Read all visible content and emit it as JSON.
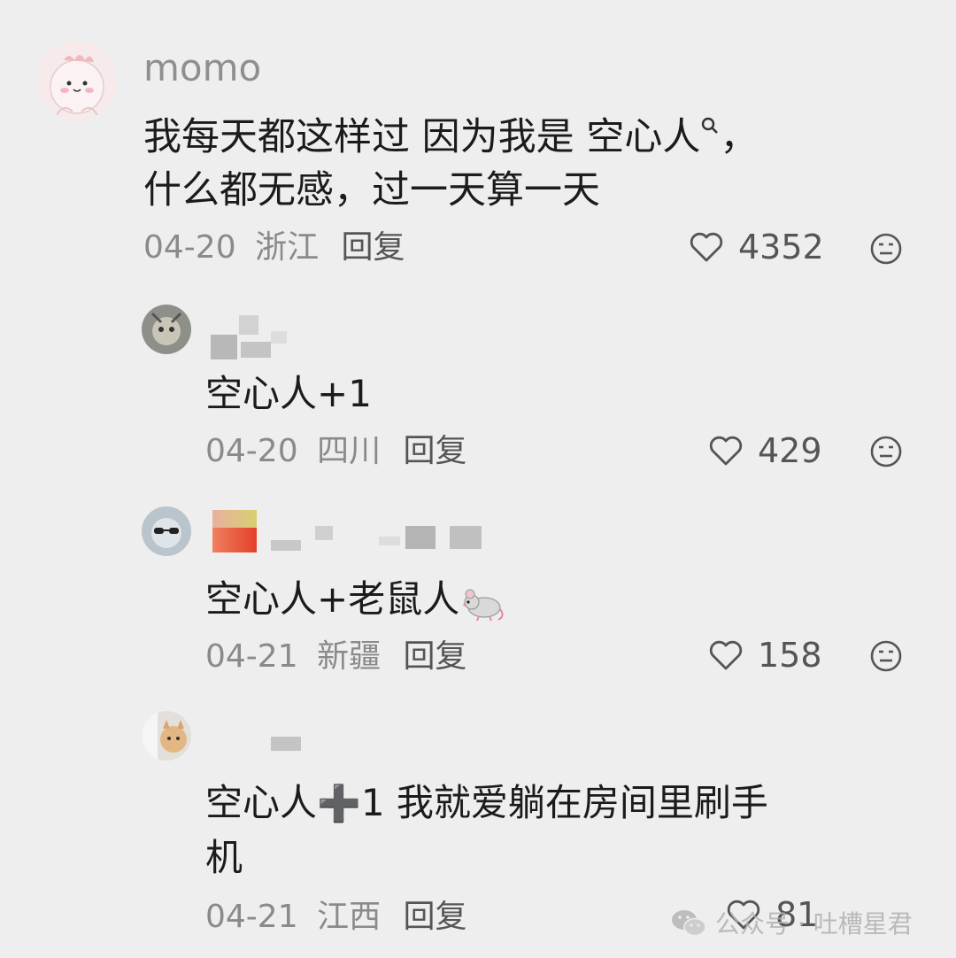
{
  "comments": [
    {
      "username": "momo",
      "line1_prefix": "我每天都这样过  因为我是",
      "keyword": "空心人",
      "line1_suffix": "，",
      "line2": "什么都无感，过一天算一天",
      "date": "04-20",
      "location": "浙江",
      "reply_label": "回复",
      "likes": "4352"
    },
    {
      "username": "",
      "text": "空心人+1",
      "date": "04-20",
      "location": "四川",
      "reply_label": "回复",
      "likes": "429"
    },
    {
      "username": "",
      "text": "空心人+老鼠人",
      "emoji": "mouse-emoji",
      "date": "04-21",
      "location": "新疆",
      "reply_label": "回复",
      "likes": "158"
    },
    {
      "username": "",
      "text_part1": "空心人",
      "plus_symbol": "➕",
      "text_part2": "1 我就爱躺在房间里刷手",
      "line2": "机",
      "date": "04-21",
      "location": "江西",
      "reply_label": "回复",
      "likes": "81"
    }
  ],
  "icons": {
    "like": "heart-outline-icon",
    "dislike": "neutral-face-icon",
    "search": "search-icon",
    "watermark": "wechat-icon"
  },
  "watermark": {
    "text": "公众号 · 吐槽星君"
  },
  "colors": {
    "background": "#eeeeee",
    "text": "#1b1b1b",
    "meta": "#8a8a8a",
    "username": "#8f8f8f"
  }
}
